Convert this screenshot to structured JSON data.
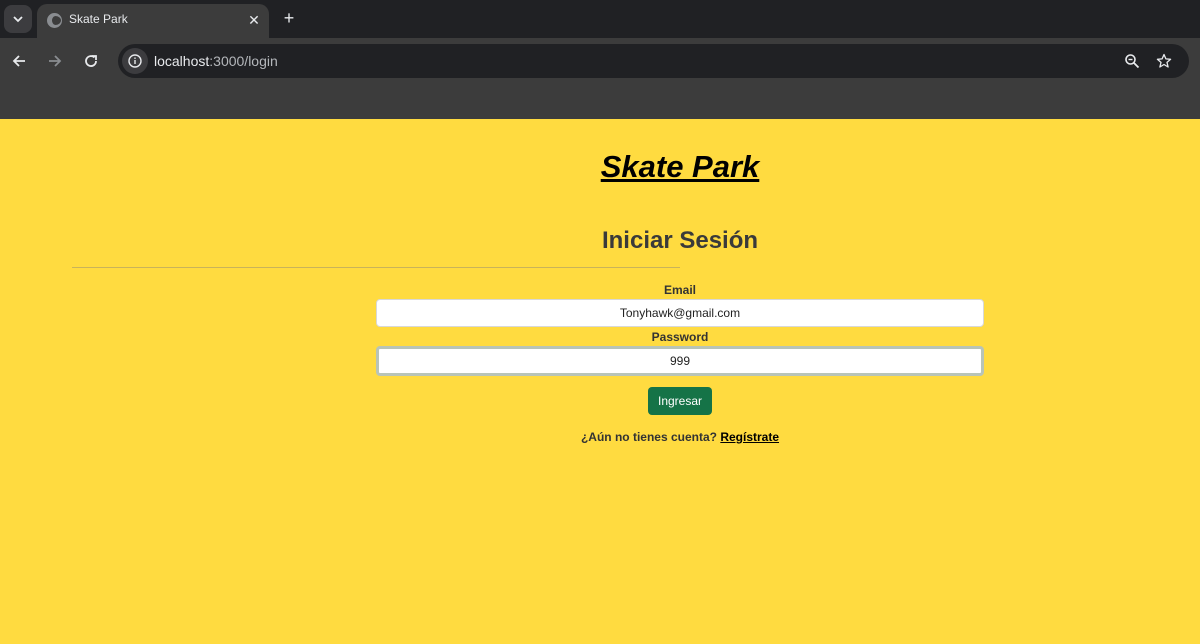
{
  "browser": {
    "tab_title": "Skate Park",
    "url_host": "localhost",
    "url_path": ":3000/login"
  },
  "page": {
    "site_title": "Skate Park",
    "section_title": "Iniciar Sesión",
    "email_label": "Email",
    "email_value": "Tonyhawk@gmail.com",
    "password_label": "Password",
    "password_value": "999",
    "submit_label": "Ingresar",
    "register_prompt": "¿Aún no tienes cuenta?",
    "register_link": "Regístrate"
  },
  "colors": {
    "page_background": "#ffdb40",
    "submit_button": "#157347"
  },
  "icons": [
    "tab-search-icon",
    "globe-icon",
    "close-icon",
    "plus-icon",
    "back-icon",
    "forward-icon",
    "reload-icon",
    "info-icon",
    "zoom-icon",
    "star-icon"
  ]
}
